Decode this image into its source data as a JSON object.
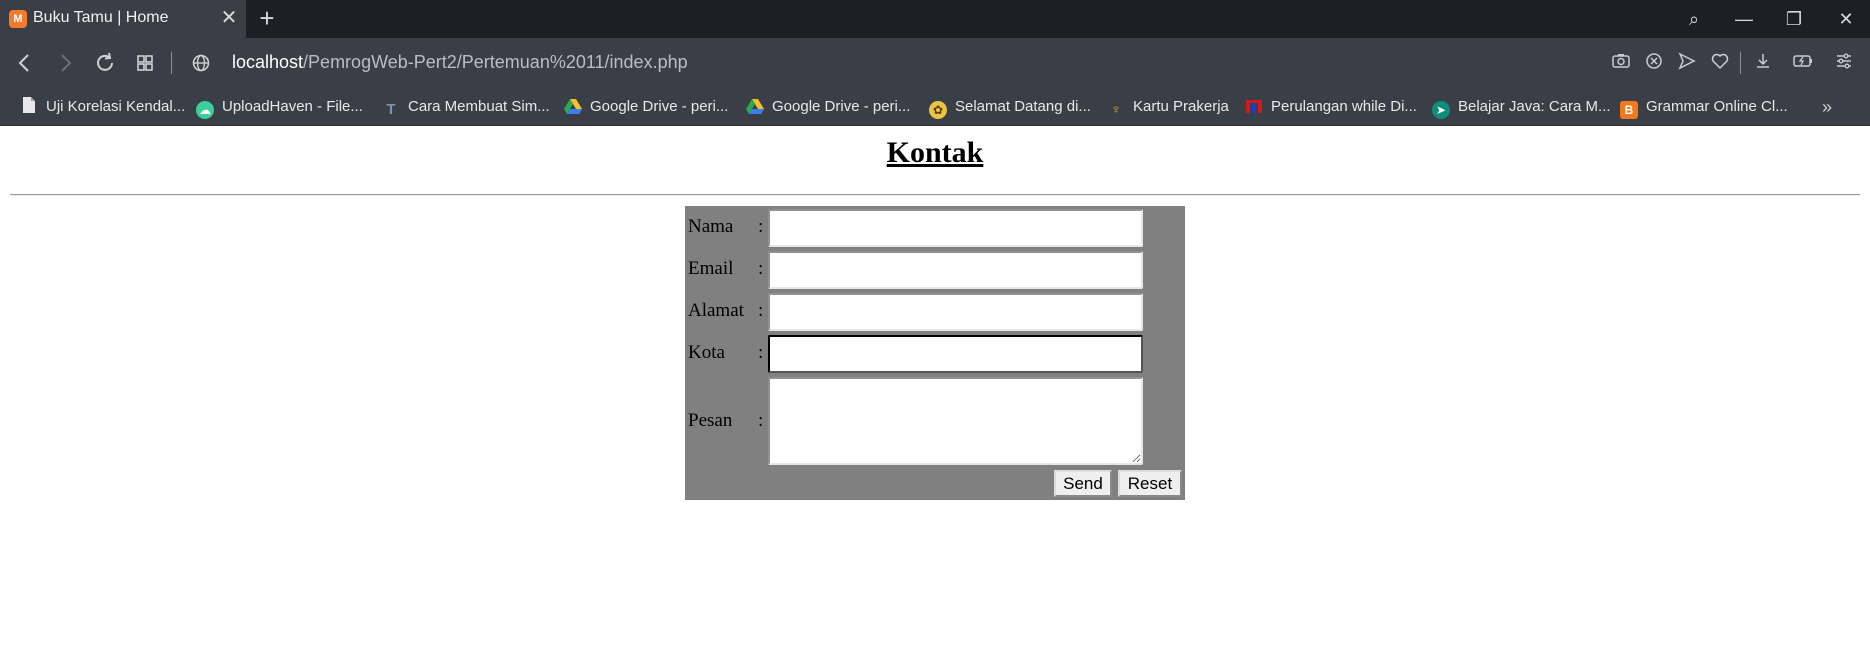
{
  "browser": {
    "tab": {
      "favicon_glyph": "M",
      "title": "Buku Tamu | Home",
      "close_glyph": "✕"
    },
    "new_tab_glyph": "+",
    "window_controls": {
      "search": "⌕",
      "minimize": "—",
      "restore": "❐",
      "close": "✕"
    },
    "address": {
      "host": "localhost",
      "path": "/PemrogWeb-Pert2/Pertemuan%2011/index.php"
    },
    "bookmarks": [
      {
        "label": "Uji Korelasi Kendal...",
        "icon": "document-icon",
        "color": "#e8e8e8"
      },
      {
        "label": "UploadHaven - File...",
        "icon": "cloud-icon",
        "color": "#3ccf9a"
      },
      {
        "label": "Cara Membuat Sim...",
        "icon": "t-logo-icon",
        "color": "#7a93b8"
      },
      {
        "label": "Google Drive - peri...",
        "icon": "google-drive-icon",
        "color": "#2da94f"
      },
      {
        "label": "Google Drive - peri...",
        "icon": "google-drive-icon",
        "color": "#2da94f"
      },
      {
        "label": "Selamat Datang di...",
        "icon": "emblem-icon",
        "color": "#e8c547"
      },
      {
        "label": "Kartu Prakerja",
        "icon": "garuda-icon",
        "color": "#c99a3a"
      },
      {
        "label": "Perulangan while Di...",
        "icon": "m-logo-icon",
        "color": "#d11b1b"
      },
      {
        "label": "Belajar Java: Cara M...",
        "icon": "bird-icon",
        "color": "#0f8c7a"
      },
      {
        "label": "Grammar Online Cl...",
        "icon": "blogger-icon",
        "color": "#f27a1a"
      }
    ],
    "more_glyph": "»"
  },
  "page": {
    "title": "Kontak",
    "form": {
      "fields": [
        {
          "label": "Nama",
          "value": ""
        },
        {
          "label": "Email",
          "value": ""
        },
        {
          "label": "Alamat",
          "value": ""
        },
        {
          "label": "Kota",
          "value": ""
        },
        {
          "label": "Pesan",
          "value": ""
        }
      ],
      "colon": ":",
      "send_label": "Send",
      "reset_label": "Reset"
    }
  },
  "colors": {
    "form_background": "#808080",
    "tab_active": "#3a3f47",
    "tabbar": "#1c1f24"
  }
}
